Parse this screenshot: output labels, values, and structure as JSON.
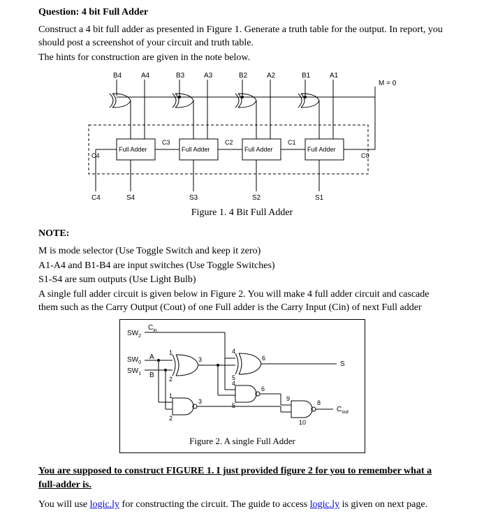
{
  "question": {
    "title": "Question: 4 bit Full Adder",
    "p1": "Construct a 4 bit full adder as presented in Figure 1. Generate a truth table for the output. In report, you should post a screenshot of your circuit and truth table.",
    "p2": "The hints for construction are given in the note below."
  },
  "figure1": {
    "inputs_top": [
      "B4",
      "A4",
      "B3",
      "A3",
      "B2",
      "A2",
      "B1",
      "A1"
    ],
    "mode_label": "M = 0",
    "adder_label": "Full Adder",
    "carries": {
      "c4": "C4",
      "c3": "C3",
      "c2": "C2",
      "c1": "C1",
      "c0": "C0"
    },
    "outputs_bottom": {
      "c4": "C4",
      "s4": "S4",
      "s3": "S3",
      "s2": "S2",
      "s1": "S1"
    },
    "caption": "Figure 1. 4 Bit Full Adder"
  },
  "note": {
    "title": "NOTE:",
    "l1": "M is mode selector (Use Toggle Switch and keep it zero)",
    "l2": "A1-A4 and B1-B4 are input switches (Use Toggle Switches)",
    "l3": "S1-S4 are sum outputs (Use Light Bulb)",
    "l4": "A single full adder circuit is given below in Figure 2. You will make 4 full adder circuit and cascade them such as the Carry Output (Cout) of one Full adder is the Carry Input (Cin) of next Full adder"
  },
  "figure2": {
    "sw2": "SW",
    "sw2_sub": "2",
    "sw0": "SW",
    "sw0_sub": "0",
    "sw1": "SW",
    "sw1_sub": "1",
    "cin": "C",
    "cin_sub": "in",
    "labels": {
      "A": "A",
      "B": "B",
      "S": "S",
      "Cout": "C",
      "Cout_sub": "out"
    },
    "nums": {
      "n1": "1",
      "n2": "2",
      "n3": "3",
      "n4": "4",
      "n5": "5",
      "n6": "6",
      "n8": "8",
      "n9": "9",
      "n10": "10"
    },
    "caption": "Figure 2. A single Full Adder"
  },
  "instruction": {
    "bold_line": "You are supposed to construct FIGURE 1.  I just provided figure 2 for you to remember what a full-adder is.",
    "last_part1": "You will use ",
    "link_text": "logic.ly",
    "last_part2": " for constructing the circuit. The guide to access ",
    "last_part3": " is given on next page."
  }
}
